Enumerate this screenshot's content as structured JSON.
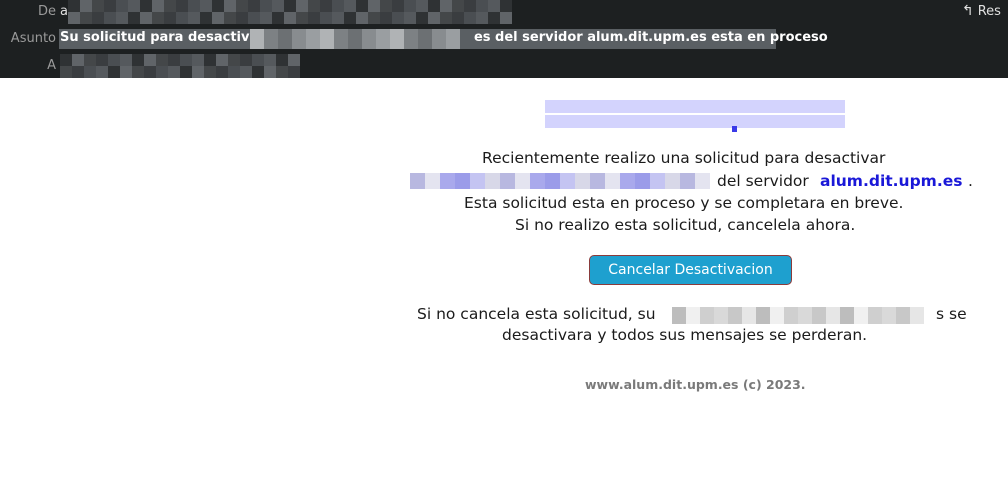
{
  "header": {
    "from_label": "De",
    "from_value": "a",
    "subject_label": "Asunto",
    "subject_visible_start": "Su solicitud para desactivar a",
    "subject_visible_end": "es del servidor alum.dit.upm.es esta en proceso",
    "to_label": "A",
    "reply_label": "Res",
    "reply_icon": "reply-arrow-icon"
  },
  "body": {
    "line1": "Recientemente realizo una solicitud para desactivar",
    "line2_server_prefix": "del servidor",
    "line2_server": "alum.dit.upm.es",
    "line2_period": ".",
    "line3": "Esta solicitud esta en proceso y se completara en breve.",
    "line4": "Si no realizo esta solicitud, cancelela ahora.",
    "cancel_button": "Cancelar Desactivacion",
    "line5_start": "Si no cancela esta solicitud, su",
    "line5_end": "s se",
    "line6": "desactivara y todos sus mensajes se perderan.",
    "footer": "www.alum.dit.upm.es (c) 2023."
  },
  "colors": {
    "header_bg": "#1d2021",
    "link_blue": "#1a18d8",
    "button_bg": "#1ea0cf",
    "button_border": "#8a3b3b",
    "footer_gray": "#7a7a7a"
  }
}
